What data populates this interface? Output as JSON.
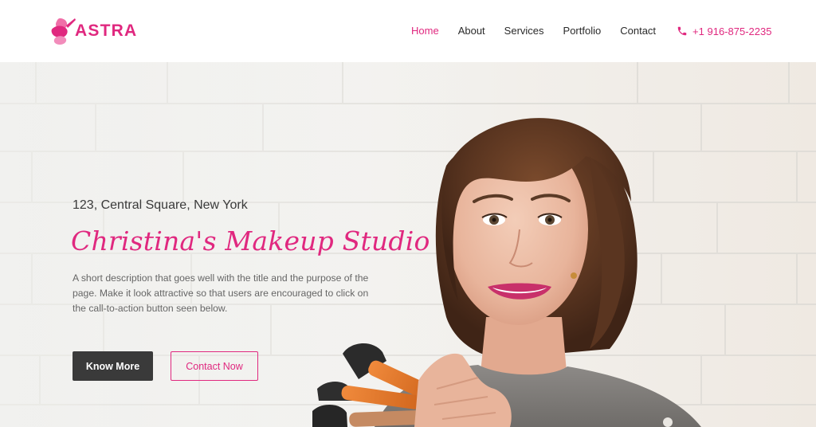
{
  "brand": {
    "name": "ASTRA",
    "logo_icon": "astra-brush-logo-icon",
    "accent_color": "#e0287f"
  },
  "nav": {
    "items": [
      {
        "label": "Home",
        "active": true
      },
      {
        "label": "About",
        "active": false
      },
      {
        "label": "Services",
        "active": false
      },
      {
        "label": "Portfolio",
        "active": false
      },
      {
        "label": "Contact",
        "active": false
      }
    ],
    "phone": {
      "icon": "phone-icon",
      "label": "+1 916-875-2235"
    }
  },
  "hero": {
    "address": "123, Central Square, New York",
    "title": "Christina's Makeup Studio",
    "description": "A short description that goes well with the title and the purpose of the page. Make it look attractive so that users are encouraged to click on the call-to-action button seen below.",
    "primary_button": "Know More",
    "secondary_button": "Contact Now",
    "dark_button_color": "#3a3a3a"
  }
}
